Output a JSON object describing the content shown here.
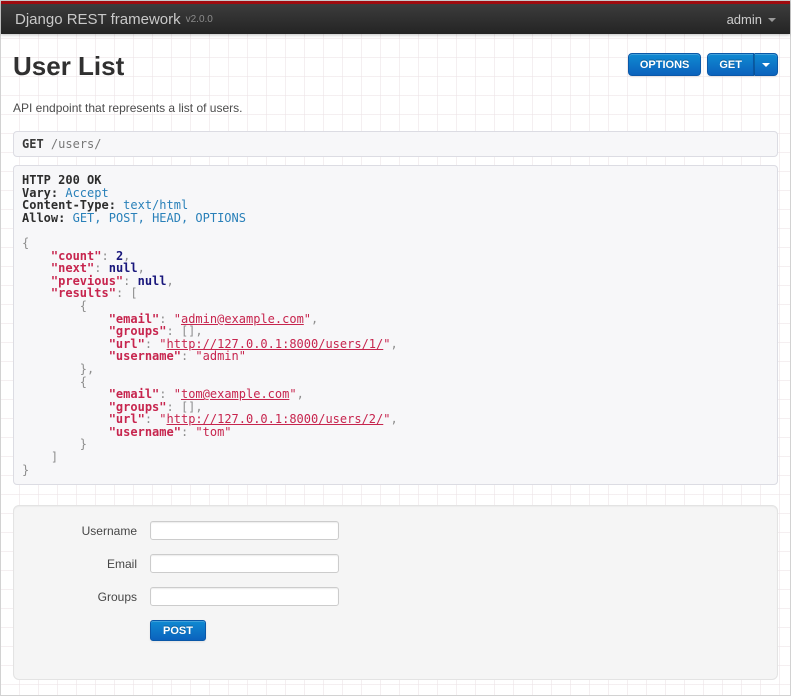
{
  "navbar": {
    "brand": "Django REST framework",
    "version": "v2.0.0",
    "user_menu": "admin"
  },
  "header": {
    "title": "User List",
    "description": "API endpoint that represents a list of users.",
    "options_button": "OPTIONS",
    "get_button": "GET"
  },
  "request": {
    "method": "GET",
    "path": "/users/"
  },
  "response": {
    "status": "HTTP 200 OK",
    "headers": [
      {
        "name": "Vary:",
        "value": "Accept"
      },
      {
        "name": "Content-Type:",
        "value": "text/html"
      },
      {
        "name": "Allow:",
        "value": "GET, POST, HEAD, OPTIONS"
      }
    ],
    "body_json": {
      "count": 2,
      "next": null,
      "previous": null,
      "results": [
        {
          "email": "admin@example.com",
          "groups": [],
          "url": "http://127.0.0.1:8000/users/1/",
          "username": "admin"
        },
        {
          "email": "tom@example.com",
          "groups": [],
          "url": "http://127.0.0.1:8000/users/2/",
          "username": "tom"
        }
      ]
    },
    "lines": [
      [
        {
          "c": "h",
          "v": "HTTP 200 OK"
        }
      ],
      [
        {
          "c": "h",
          "v": "Vary:"
        },
        {
          "c": "p",
          "v": " "
        },
        {
          "c": "v",
          "v": "Accept"
        }
      ],
      [
        {
          "c": "h",
          "v": "Content-Type:"
        },
        {
          "c": "p",
          "v": " "
        },
        {
          "c": "v",
          "v": "text/html"
        }
      ],
      [
        {
          "c": "h",
          "v": "Allow:"
        },
        {
          "c": "p",
          "v": " "
        },
        {
          "c": "v",
          "v": "GET, POST, HEAD, OPTIONS"
        }
      ],
      [],
      [
        {
          "c": "p",
          "v": "{"
        }
      ],
      [
        {
          "c": "p",
          "v": "    "
        },
        {
          "c": "k",
          "v": "\"count\""
        },
        {
          "c": "p",
          "v": ": "
        },
        {
          "c": "n",
          "v": "2"
        },
        {
          "c": "p",
          "v": ","
        }
      ],
      [
        {
          "c": "p",
          "v": "    "
        },
        {
          "c": "k",
          "v": "\"next\""
        },
        {
          "c": "p",
          "v": ": "
        },
        {
          "c": "n",
          "v": "null"
        },
        {
          "c": "p",
          "v": ","
        }
      ],
      [
        {
          "c": "p",
          "v": "    "
        },
        {
          "c": "k",
          "v": "\"previous\""
        },
        {
          "c": "p",
          "v": ": "
        },
        {
          "c": "n",
          "v": "null"
        },
        {
          "c": "p",
          "v": ","
        }
      ],
      [
        {
          "c": "p",
          "v": "    "
        },
        {
          "c": "k",
          "v": "\"results\""
        },
        {
          "c": "p",
          "v": ": ["
        }
      ],
      [
        {
          "c": "p",
          "v": "        {"
        }
      ],
      [
        {
          "c": "p",
          "v": "            "
        },
        {
          "c": "k",
          "v": "\"email\""
        },
        {
          "c": "p",
          "v": ": "
        },
        {
          "c": "s",
          "v": "\""
        },
        {
          "c": "a",
          "v": "admin@example.com"
        },
        {
          "c": "s",
          "v": "\""
        },
        {
          "c": "p",
          "v": ","
        }
      ],
      [
        {
          "c": "p",
          "v": "            "
        },
        {
          "c": "k",
          "v": "\"groups\""
        },
        {
          "c": "p",
          "v": ": [],"
        }
      ],
      [
        {
          "c": "p",
          "v": "            "
        },
        {
          "c": "k",
          "v": "\"url\""
        },
        {
          "c": "p",
          "v": ": "
        },
        {
          "c": "s",
          "v": "\""
        },
        {
          "c": "a",
          "v": "http://127.0.0.1:8000/users/1/"
        },
        {
          "c": "s",
          "v": "\""
        },
        {
          "c": "p",
          "v": ","
        }
      ],
      [
        {
          "c": "p",
          "v": "            "
        },
        {
          "c": "k",
          "v": "\"username\""
        },
        {
          "c": "p",
          "v": ": "
        },
        {
          "c": "s",
          "v": "\"admin\""
        }
      ],
      [
        {
          "c": "p",
          "v": "        },"
        }
      ],
      [
        {
          "c": "p",
          "v": "        {"
        }
      ],
      [
        {
          "c": "p",
          "v": "            "
        },
        {
          "c": "k",
          "v": "\"email\""
        },
        {
          "c": "p",
          "v": ": "
        },
        {
          "c": "s",
          "v": "\""
        },
        {
          "c": "a",
          "v": "tom@example.com"
        },
        {
          "c": "s",
          "v": "\""
        },
        {
          "c": "p",
          "v": ","
        }
      ],
      [
        {
          "c": "p",
          "v": "            "
        },
        {
          "c": "k",
          "v": "\"groups\""
        },
        {
          "c": "p",
          "v": ": [],"
        }
      ],
      [
        {
          "c": "p",
          "v": "            "
        },
        {
          "c": "k",
          "v": "\"url\""
        },
        {
          "c": "p",
          "v": ": "
        },
        {
          "c": "s",
          "v": "\""
        },
        {
          "c": "a",
          "v": "http://127.0.0.1:8000/users/2/"
        },
        {
          "c": "s",
          "v": "\""
        },
        {
          "c": "p",
          "v": ","
        }
      ],
      [
        {
          "c": "p",
          "v": "            "
        },
        {
          "c": "k",
          "v": "\"username\""
        },
        {
          "c": "p",
          "v": ": "
        },
        {
          "c": "s",
          "v": "\"tom\""
        }
      ],
      [
        {
          "c": "p",
          "v": "        }"
        }
      ],
      [
        {
          "c": "p",
          "v": "    ]"
        }
      ],
      [
        {
          "c": "p",
          "v": "}"
        }
      ]
    ]
  },
  "form": {
    "fields": [
      {
        "label": "Username"
      },
      {
        "label": "Email"
      },
      {
        "label": "Groups"
      }
    ],
    "submit_label": "POST"
  },
  "colors": {
    "navbar_red": "#9e0b0f",
    "navbar_bg": "#2d2d2d",
    "button_blue": "#0b6cc4",
    "json_key": "#c7254e",
    "json_literal": "#19177c",
    "header_value_blue": "#2980b9",
    "panel_bg": "#f7f7f9"
  }
}
